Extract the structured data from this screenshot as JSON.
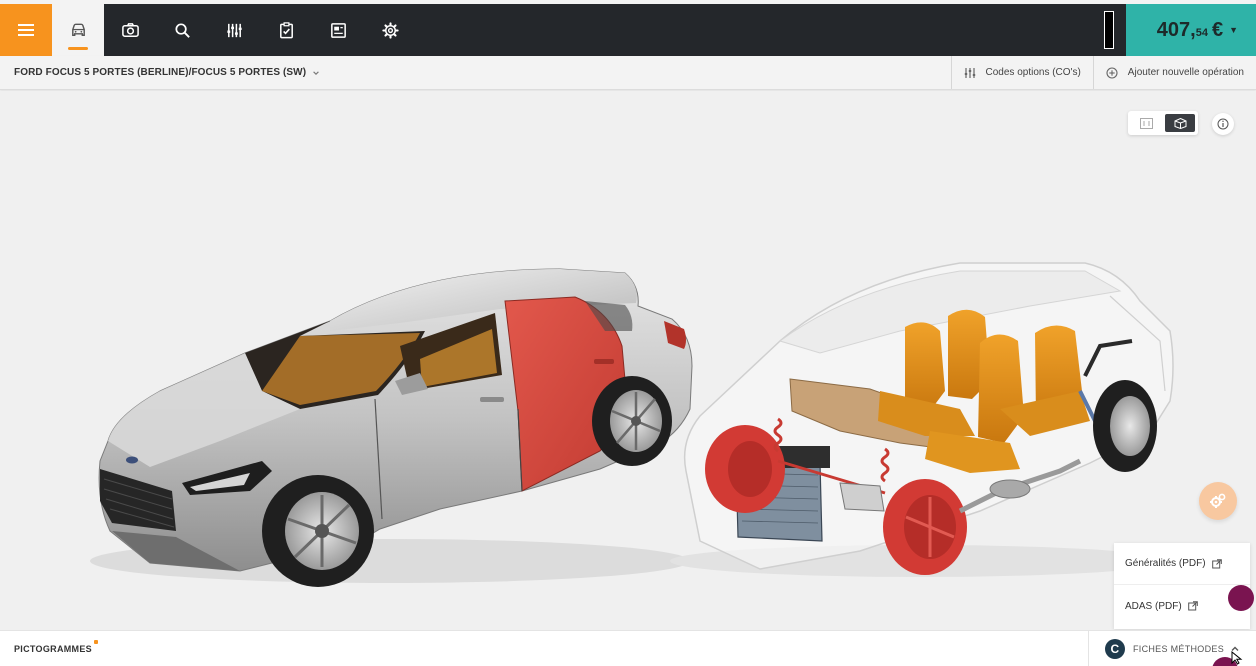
{
  "topbar": {
    "nav_icons": [
      "menu-icon",
      "car-icon",
      "camera-icon",
      "search-icon",
      "sliders-icon",
      "clipboard-check-icon",
      "document-icon",
      "gear-icon"
    ],
    "active_index": 1,
    "price": {
      "integer": "407,",
      "decimals": "54",
      "currency": "€"
    }
  },
  "subbar": {
    "vehicle_title": "FORD FOCUS 5 PORTES (BERLINE)/FOCUS 5 PORTES (SW)",
    "codes_options_label": "Codes options (CO's)",
    "add_operation_label": "Ajouter nouvelle opération"
  },
  "viewport": {
    "view_mode_selected": "3d",
    "highlight_color": "#d94a3f",
    "accent_color": "#f7931e"
  },
  "methods_panel": {
    "items": [
      {
        "label": "Généralités (PDF)"
      },
      {
        "label": "ADAS (PDF)"
      }
    ]
  },
  "bottombar": {
    "pictogrammes_label": "PICTOGRAMMES",
    "fiches_logo_letter": "C",
    "fiches_label": "FICHES MÉTHODES"
  }
}
